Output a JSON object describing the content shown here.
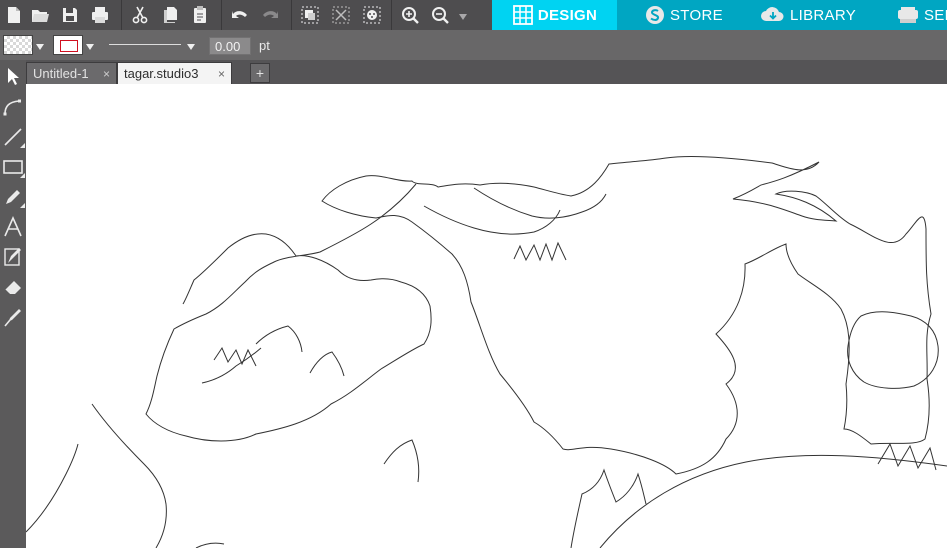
{
  "toolbar": {
    "icons": [
      "new-document-icon",
      "open-folder-icon",
      "save-icon",
      "print-icon",
      "cut-icon",
      "copy-icon",
      "paste-icon",
      "undo-icon",
      "redo-icon",
      "group-icon",
      "ungroup-icon",
      "replicate-icon",
      "zoom-in-icon",
      "zoom-out-icon"
    ]
  },
  "nav": {
    "design": "DESIGN",
    "store": "STORE",
    "library": "LIBRARY",
    "send": "SEND"
  },
  "linebar": {
    "line_weight": "0.00",
    "unit": "pt"
  },
  "tabs": [
    {
      "label": "Untitled-1",
      "close": "×"
    },
    {
      "label": "tagar.studio3",
      "close": "×"
    }
  ],
  "add_tab": "+",
  "colors": {
    "accent": "#00a6c2",
    "accent_active": "#00d3f2",
    "toolbar": "#4e4d4f",
    "canvas": "#ffffff",
    "stroke_color": "#d01020"
  }
}
